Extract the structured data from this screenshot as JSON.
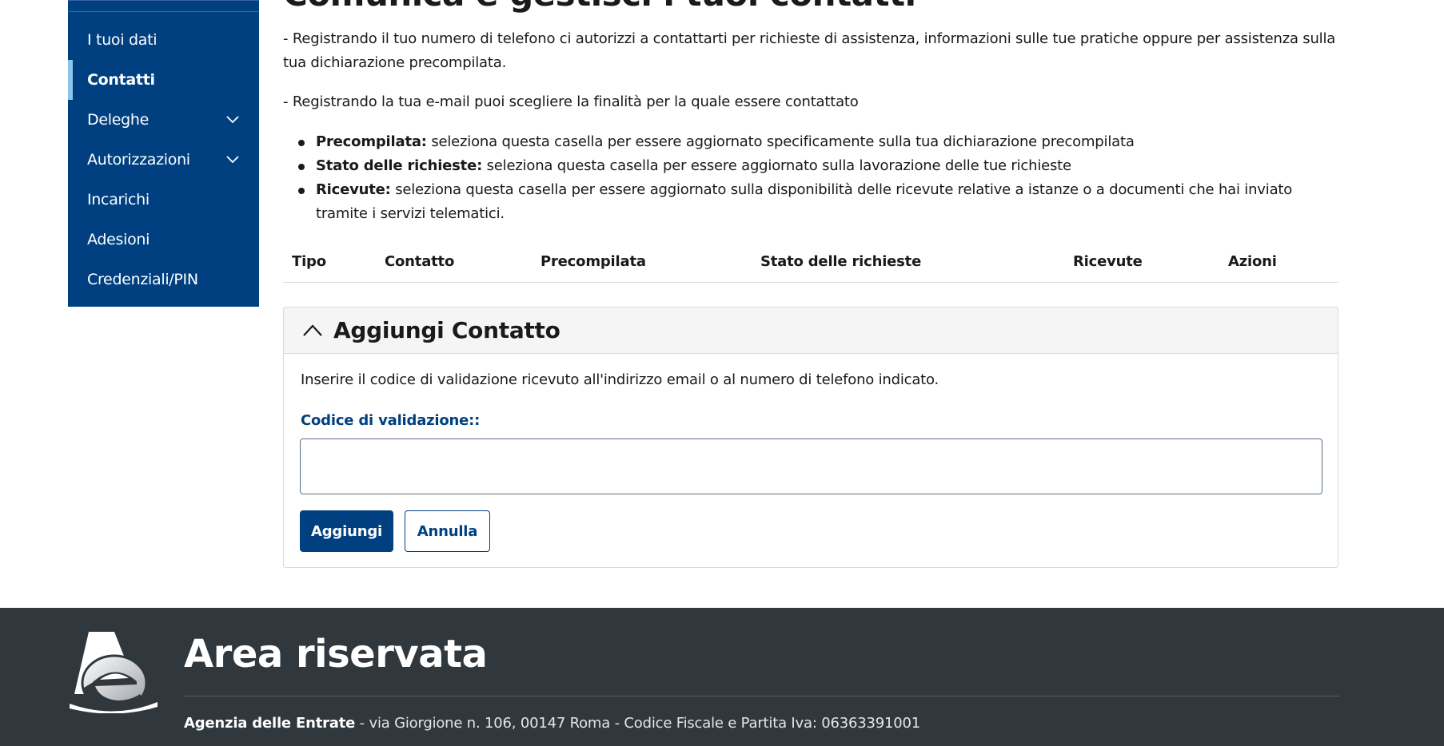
{
  "sidebar": {
    "items": [
      {
        "label": "I tuoi dati",
        "active": false,
        "expandable": false
      },
      {
        "label": "Contatti",
        "active": true,
        "expandable": false
      },
      {
        "label": "Deleghe",
        "active": false,
        "expandable": true
      },
      {
        "label": "Autorizzazioni",
        "active": false,
        "expandable": true
      },
      {
        "label": "Incarichi",
        "active": false,
        "expandable": false
      },
      {
        "label": "Adesioni",
        "active": false,
        "expandable": false
      },
      {
        "label": "Credenziali/PIN",
        "active": false,
        "expandable": false
      }
    ]
  },
  "main": {
    "title": "Comunica e gestisci i tuoi contatti",
    "para1": "- Registrando il tuo numero di telefono ci autorizzi a contattarti per richieste di assistenza, informazioni sulle tue pratiche oppure per assistenza sulla tua dichiarazione precompilata.",
    "para2": "- Registrando la tua e-mail puoi scegliere la finalità per la quale essere contattato",
    "bullets": [
      {
        "term": "Precompilata:",
        "text": " seleziona questa casella per essere aggiornato specificamente sulla tua dichiarazione precompilata"
      },
      {
        "term": "Stato delle richieste:",
        "text": " seleziona questa casella per essere aggiornato sulla lavorazione delle tue richieste"
      },
      {
        "term": "Ricevute:",
        "text": " seleziona questa casella per essere aggiornato sulla disponibilità delle ricevute relative a istanze o a documenti che hai inviato tramite i servizi telematici."
      }
    ],
    "table_headers": [
      "Tipo",
      "Contatto",
      "Precompilata",
      "Stato delle richieste",
      "Ricevute",
      "Azioni"
    ]
  },
  "accordion": {
    "title": "Aggiungi Contatto",
    "description": "Inserire il codice di validazione ricevuto all'indirizzo email o al numero di telefono indicato.",
    "field_label": "Codice di validazione::",
    "field_value": "",
    "submit_label": "Aggiungi",
    "cancel_label": "Annulla"
  },
  "footer": {
    "title": "Area riservata",
    "org": "Agenzia delle Entrate",
    "info": " - via Giorgione n. 106, 00147 Roma - Codice Fiscale e Partita Iva: 06363391001"
  },
  "colors": {
    "primary": "#004080",
    "active_indicator": "#8ec3f0",
    "footer_bg": "#30373d"
  }
}
